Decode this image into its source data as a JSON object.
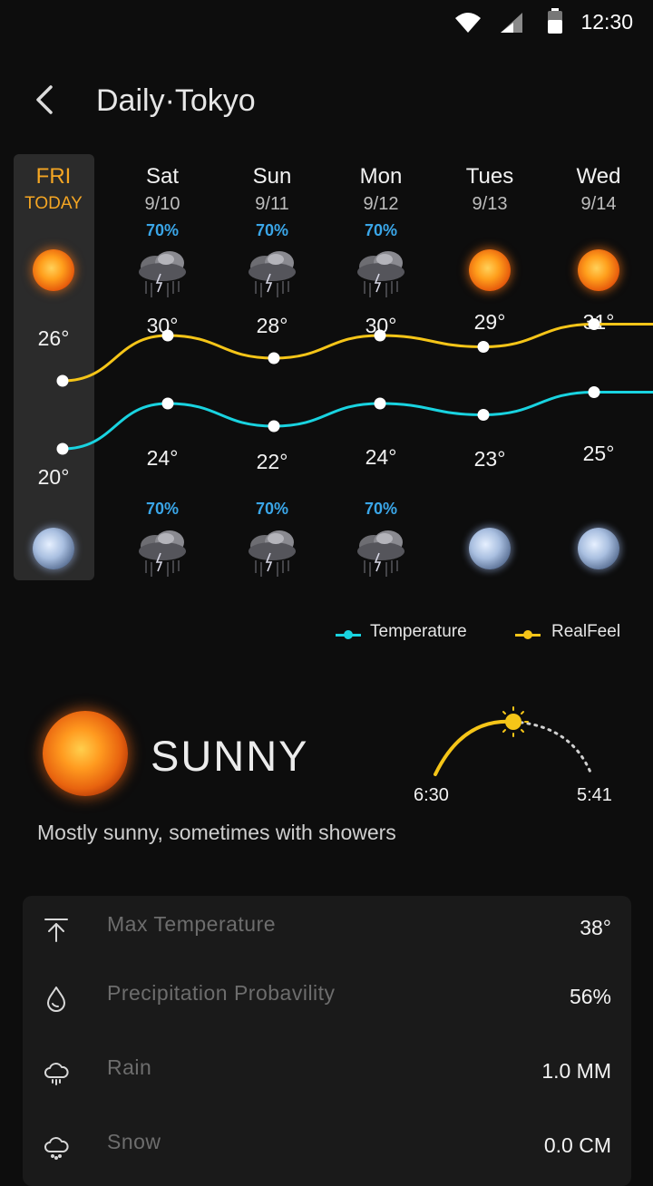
{
  "status_bar": {
    "time": "12:30"
  },
  "header": {
    "title": "Daily·Tokyo"
  },
  "days": [
    {
      "name": "FRI",
      "date": "TODAY",
      "today": true,
      "day_icon": "sun-icon",
      "night_icon": "moon-icon",
      "high": "26°",
      "low": "20°",
      "day_precip": "",
      "night_precip": ""
    },
    {
      "name": "Sat",
      "date": "9/10",
      "day_icon": "thunderstorm-icon",
      "night_icon": "thunderstorm-icon",
      "high": "30°",
      "low": "24°",
      "day_precip": "70%",
      "night_precip": "70%"
    },
    {
      "name": "Sun",
      "date": "9/11",
      "day_icon": "thunderstorm-icon",
      "night_icon": "thunderstorm-icon",
      "high": "28°",
      "low": "22°",
      "day_precip": "70%",
      "night_precip": "70%"
    },
    {
      "name": "Mon",
      "date": "9/12",
      "day_icon": "thunderstorm-icon",
      "night_icon": "thunderstorm-icon",
      "high": "30°",
      "low": "24°",
      "day_precip": "70%",
      "night_precip": "70%"
    },
    {
      "name": "Tues",
      "date": "9/13",
      "day_icon": "sun-icon",
      "night_icon": "moon-icon",
      "high": "29°",
      "low": "23°",
      "day_precip": "",
      "night_precip": ""
    },
    {
      "name": "Wed",
      "date": "9/14",
      "day_icon": "sun-icon",
      "night_icon": "moon-icon",
      "high": "31°",
      "low": "25°",
      "day_precip": "",
      "night_precip": ""
    }
  ],
  "chart_data": {
    "type": "line",
    "categories": [
      "FRI",
      "Sat",
      "Sun",
      "Mon",
      "Tues",
      "Wed"
    ],
    "series": [
      {
        "name": "RealFeel",
        "values": [
          26,
          30,
          28,
          30,
          29,
          31
        ],
        "color": "#f5c518"
      },
      {
        "name": "Temperature",
        "values": [
          20,
          24,
          22,
          24,
          23,
          25
        ],
        "color": "#19d3e0"
      }
    ]
  },
  "legend": {
    "temperature": "Temperature",
    "realfeel": "RealFeel",
    "temperature_color": "#19d3e0",
    "realfeel_color": "#f5c518"
  },
  "current": {
    "condition": "SUNNY",
    "description": "Mostly sunny, sometimes with showers",
    "sunrise": "6:30",
    "sunset": "5:41"
  },
  "details": [
    {
      "icon": "arrow-up-icon",
      "label": "Max Temperature",
      "value": "38°"
    },
    {
      "icon": "droplet-icon",
      "label": "Precipitation Probavility",
      "value": "56%"
    },
    {
      "icon": "rain-cloud-icon",
      "label": "Rain",
      "value": "1.0 MM"
    },
    {
      "icon": "snow-cloud-icon",
      "label": "Snow",
      "value": "0.0 CM"
    }
  ]
}
